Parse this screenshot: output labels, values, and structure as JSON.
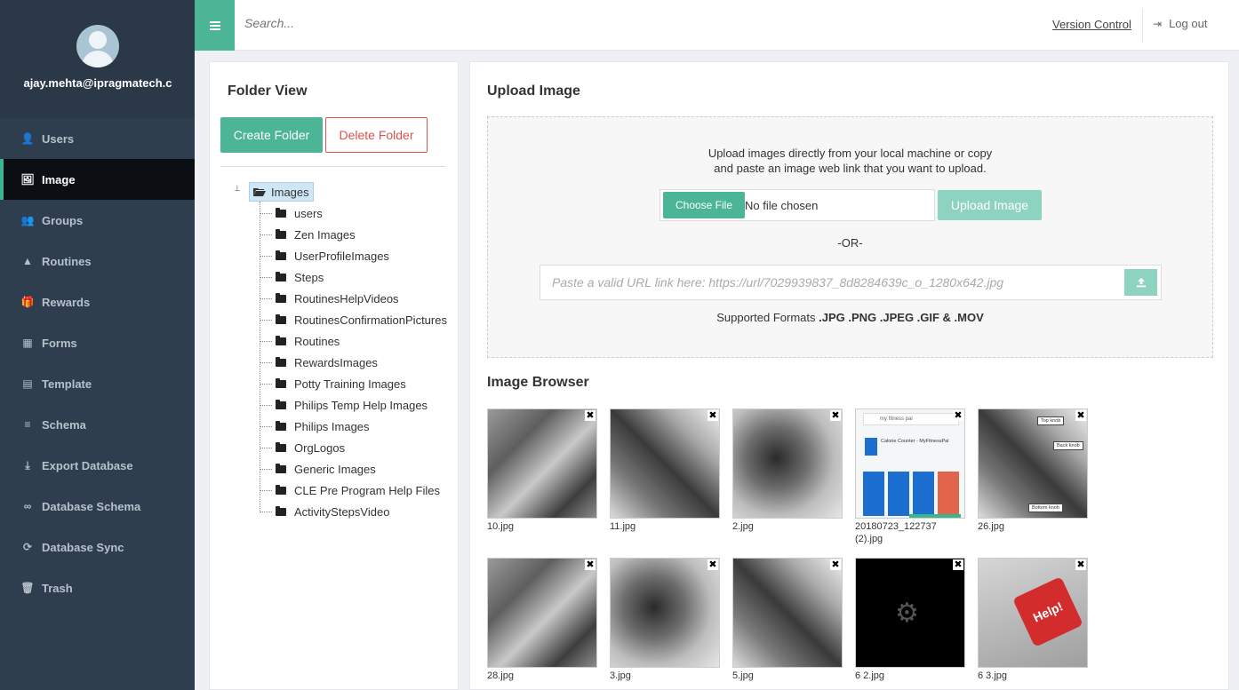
{
  "user": {
    "email": "ajay.mehta@ipragmatech.c"
  },
  "sidebar": {
    "items": [
      {
        "label": "Users",
        "icon": "user-icon",
        "glyph": "👤"
      },
      {
        "label": "Image",
        "icon": "image-icon",
        "glyph": "🖼"
      },
      {
        "label": "Groups",
        "icon": "groups-icon",
        "glyph": "👥"
      },
      {
        "label": "Routines",
        "icon": "routines-icon",
        "glyph": "▲"
      },
      {
        "label": "Rewards",
        "icon": "gift-icon",
        "glyph": "🎁"
      },
      {
        "label": "Forms",
        "icon": "table-icon",
        "glyph": "▦"
      },
      {
        "label": "Template",
        "icon": "file-icon",
        "glyph": "▤"
      },
      {
        "label": "Schema",
        "icon": "database-icon",
        "glyph": "≡"
      },
      {
        "label": "Export Database",
        "icon": "download-icon",
        "glyph": "⤓"
      },
      {
        "label": "Database Schema",
        "icon": "link-icon",
        "glyph": "∞"
      },
      {
        "label": "Database Sync",
        "icon": "refresh-icon",
        "glyph": "⟳"
      },
      {
        "label": "Trash",
        "icon": "trash-icon",
        "glyph": "🗑"
      }
    ],
    "active_index": 1
  },
  "topbar": {
    "search_placeholder": "Search...",
    "version_control": "Version Control",
    "logout": "Log out"
  },
  "folder_view": {
    "title": "Folder View",
    "create_label": "Create Folder",
    "delete_label": "Delete Folder",
    "root": "Images",
    "folders": [
      "users",
      "Zen Images",
      "UserProfileImages",
      "Steps",
      "RoutinesHelpVideos",
      "RoutinesConfirmationPictures",
      "Routines",
      "RewardsImages",
      "Potty Training Images",
      "Philips Temp Help Images",
      "Philips Images",
      "OrgLogos",
      "Generic Images",
      "CLE Pre Program Help Files",
      "ActivityStepsVideo"
    ]
  },
  "upload": {
    "title": "Upload Image",
    "line1": "Upload images directly from your local machine or copy",
    "line2": "and paste an image web link that you want to upload.",
    "choose_file": "Choose File",
    "no_file": "No file chosen",
    "upload_button": "Upload Image",
    "or": "-OR-",
    "url_placeholder": "Paste a valid URL link here: https://url/7029939837_8d8284639c_o_1280x642.jpg",
    "formats_prefix": "Supported Formats",
    "formats": ".JPG .PNG .JPEG .GIF & .MOV"
  },
  "browser": {
    "title": "Image Browser",
    "images": [
      {
        "name": "10.jpg"
      },
      {
        "name": "11.jpg"
      },
      {
        "name": "2.jpg"
      },
      {
        "name": "20180723_122737 (2).jpg"
      },
      {
        "name": "26.jpg"
      },
      {
        "name": "28.jpg"
      },
      {
        "name": "3.jpg"
      },
      {
        "name": "5.jpg"
      },
      {
        "name": "6 2.jpg"
      },
      {
        "name": "6 3.jpg"
      }
    ],
    "thumb_texts": {
      "app_title": "my fitness pal",
      "app_name": "Calorie Counter - MyFitnessPal",
      "tag1": "Top knob",
      "tag2": "Back knob",
      "tag3": "Bottom knob",
      "help": "Help!"
    }
  },
  "colors": {
    "accent": "#4cb596",
    "sidebar": "#2f3e4e",
    "danger": "#d9534f"
  }
}
